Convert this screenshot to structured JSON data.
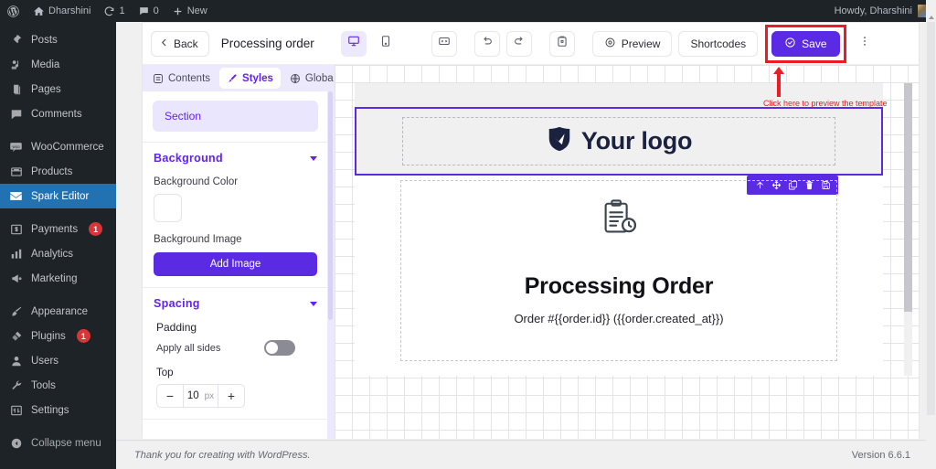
{
  "adminbar": {
    "logo_icon": "wordpress-logo-icon",
    "site_icon": "home-icon",
    "site_name": "Dharshini",
    "updates_icon": "updates-icon",
    "updates_count": "1",
    "comments_icon": "comment-bubble-icon",
    "comments_count": "0",
    "new_icon": "plus-icon",
    "new_label": "New",
    "howdy": "Howdy, Dharshini",
    "avatar": "user-avatar"
  },
  "sidebar": {
    "items": [
      {
        "label": "Posts",
        "icon": "pin-icon"
      },
      {
        "label": "Media",
        "icon": "media-icon"
      },
      {
        "label": "Pages",
        "icon": "pages-icon"
      },
      {
        "label": "Comments",
        "icon": "comment-icon"
      },
      {
        "label": "WooCommerce",
        "icon": "woocommerce-icon"
      },
      {
        "label": "Products",
        "icon": "products-icon"
      },
      {
        "label": "Spark Editor",
        "icon": "envelope-icon",
        "active": true
      },
      {
        "label": "Payments",
        "icon": "payments-icon",
        "badge": "1"
      },
      {
        "label": "Analytics",
        "icon": "analytics-icon"
      },
      {
        "label": "Marketing",
        "icon": "megaphone-icon"
      },
      {
        "label": "Appearance",
        "icon": "paintbrush-icon"
      },
      {
        "label": "Plugins",
        "icon": "plugin-icon",
        "badge": "1"
      },
      {
        "label": "Users",
        "icon": "user-icon"
      },
      {
        "label": "Tools",
        "icon": "wrench-icon"
      },
      {
        "label": "Settings",
        "icon": "settings-sliders-icon"
      },
      {
        "label": "Collapse menu",
        "icon": "collapse-arrow-icon"
      }
    ]
  },
  "editor": {
    "back_label": "Back",
    "title": "Processing order",
    "devices": [
      {
        "name": "desktop-view",
        "icon": "monitor-icon",
        "active": true
      },
      {
        "name": "mobile-view",
        "icon": "mobile-icon",
        "active": false
      }
    ],
    "tools": [
      {
        "name": "code-view",
        "icon": "code-brackets-icon"
      },
      {
        "name": "undo",
        "icon": "undo-arrow-icon"
      },
      {
        "name": "redo",
        "icon": "redo-arrow-icon"
      },
      {
        "name": "clipboard",
        "icon": "clipboard-icon"
      }
    ],
    "preview_label": "Preview",
    "preview_icon": "eye-target-icon",
    "shortcodes_label": "Shortcodes",
    "save_label": "Save",
    "save_icon": "check-circle-icon",
    "more_icon": "kebab-menu-icon",
    "accent_color": "#5b2be3",
    "highlight_color": "#ed1c24"
  },
  "panel": {
    "tabs": [
      {
        "label": "Contents",
        "icon": "contents-list-icon",
        "active": false
      },
      {
        "label": "Styles",
        "icon": "brush-icon",
        "active": true
      },
      {
        "label": "Global",
        "icon": "globe-icon",
        "active": false
      }
    ],
    "selected_element": "Section",
    "background": {
      "title": "Background",
      "color_label": "Background Color",
      "color_value": "#ffffff",
      "image_label": "Background Image",
      "add_image_label": "Add Image"
    },
    "spacing": {
      "title": "Spacing",
      "padding_label": "Padding",
      "apply_all_label": "Apply all sides",
      "apply_all_on": false,
      "top_label": "Top",
      "top_value": "10",
      "unit": "px",
      "minus": "−",
      "plus": "+"
    }
  },
  "canvas": {
    "logo_text": "Your logo",
    "logo_icon": "shield-badge-icon",
    "status_icon": "clipboard-clock-icon",
    "heading": "Processing Order",
    "subtext": "Order #{{order.id}} ({{order.created_at}})",
    "float_toolbar": [
      {
        "name": "move-up",
        "icon": "arrow-up-icon"
      },
      {
        "name": "drag",
        "icon": "move-cross-icon"
      },
      {
        "name": "duplicate",
        "icon": "copy-icon"
      },
      {
        "name": "delete",
        "icon": "trash-icon"
      },
      {
        "name": "save-block",
        "icon": "save-disk-icon"
      }
    ]
  },
  "annotation": {
    "text": "Click here to preview the template",
    "color": "#ed1c24"
  },
  "footer": {
    "thanks": "Thank you for creating with WordPress.",
    "version": "Version 6.6.1"
  }
}
